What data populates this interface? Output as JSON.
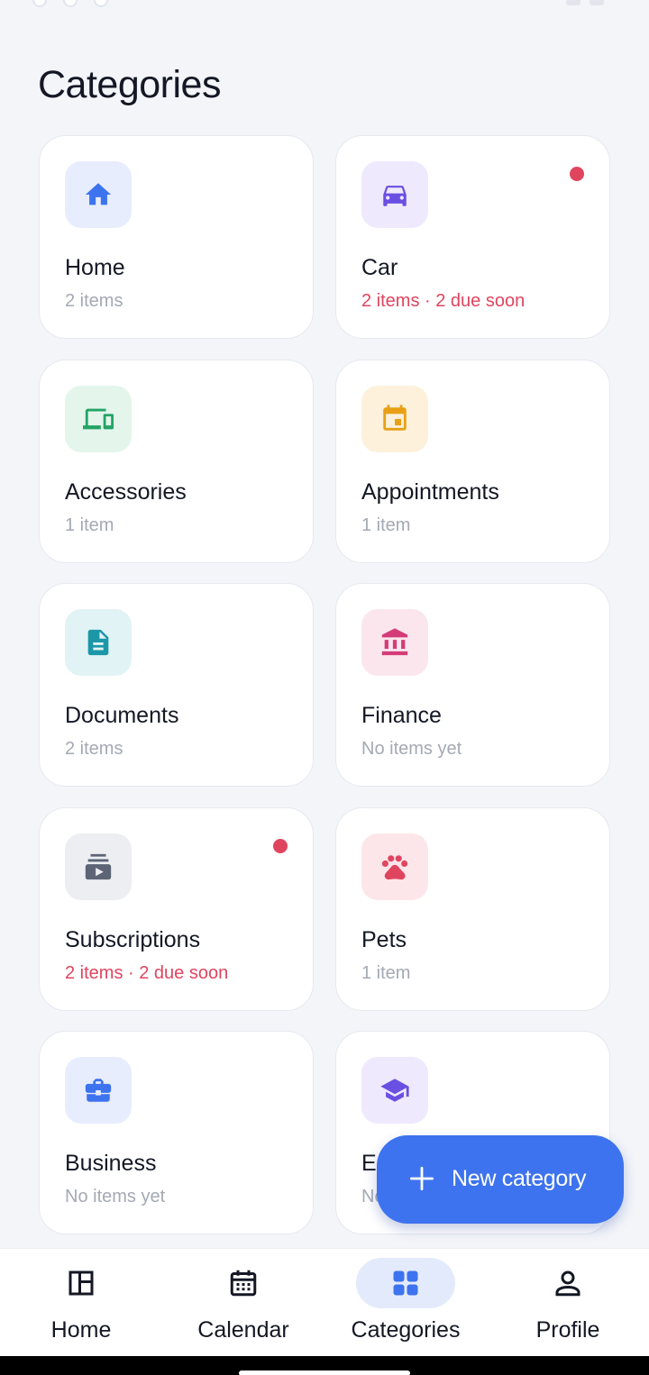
{
  "header": {
    "title": "Categories"
  },
  "categories": [
    {
      "name": "Home",
      "subtitle": "2 items",
      "due": false,
      "dot": false,
      "icon": "home-icon",
      "icon_color": "#3d73ee",
      "icon_bg": "#e7edfd"
    },
    {
      "name": "Car",
      "subtitle": "2 items · 2 due soon",
      "due": true,
      "dot": true,
      "icon": "car-icon",
      "icon_color": "#6a4fe3",
      "icon_bg": "#eee9fd"
    },
    {
      "name": "Accessories",
      "subtitle": "1 item",
      "due": false,
      "dot": false,
      "icon": "devices-icon",
      "icon_color": "#22a565",
      "icon_bg": "#e4f5ec"
    },
    {
      "name": "Appointments",
      "subtitle": "1 item",
      "due": false,
      "dot": false,
      "icon": "calendar-event-icon",
      "icon_color": "#e8a116",
      "icon_bg": "#fdf1dc"
    },
    {
      "name": "Documents",
      "subtitle": "2 items",
      "due": false,
      "dot": false,
      "icon": "document-icon",
      "icon_color": "#1b97a8",
      "icon_bg": "#e2f3f5"
    },
    {
      "name": "Finance",
      "subtitle": "No items yet",
      "due": false,
      "dot": false,
      "icon": "bank-icon",
      "icon_color": "#d43c78",
      "icon_bg": "#fbe6ee"
    },
    {
      "name": "Subscriptions",
      "subtitle": "2 items · 2 due soon",
      "due": true,
      "dot": true,
      "icon": "subscriptions-icon",
      "icon_color": "#5d6475",
      "icon_bg": "#eceef2"
    },
    {
      "name": "Pets",
      "subtitle": "1 item",
      "due": false,
      "dot": false,
      "icon": "paw-icon",
      "icon_color": "#e0455f",
      "icon_bg": "#fde6e9"
    },
    {
      "name": "Business",
      "subtitle": "No items yet",
      "due": false,
      "dot": false,
      "icon": "briefcase-icon",
      "icon_color": "#3d73ee",
      "icon_bg": "#e7edfd"
    },
    {
      "name": "Ed",
      "subtitle": "No",
      "due": false,
      "dot": false,
      "icon": "graduation-cap-icon",
      "icon_color": "#6a4fe3",
      "icon_bg": "#eee9fd"
    }
  ],
  "fab": {
    "label": "New category",
    "icon": "plus-icon"
  },
  "bottom_nav": {
    "items": [
      {
        "label": "Home",
        "icon": "dashboard-icon",
        "active": false
      },
      {
        "label": "Calendar",
        "icon": "calendar-icon",
        "active": false
      },
      {
        "label": "Categories",
        "icon": "grid-icon",
        "active": true
      },
      {
        "label": "Profile",
        "icon": "person-icon",
        "active": false
      }
    ]
  },
  "colors": {
    "accent": "#3d73ee",
    "due": "#e0455f",
    "background": "#f3f5f9"
  }
}
